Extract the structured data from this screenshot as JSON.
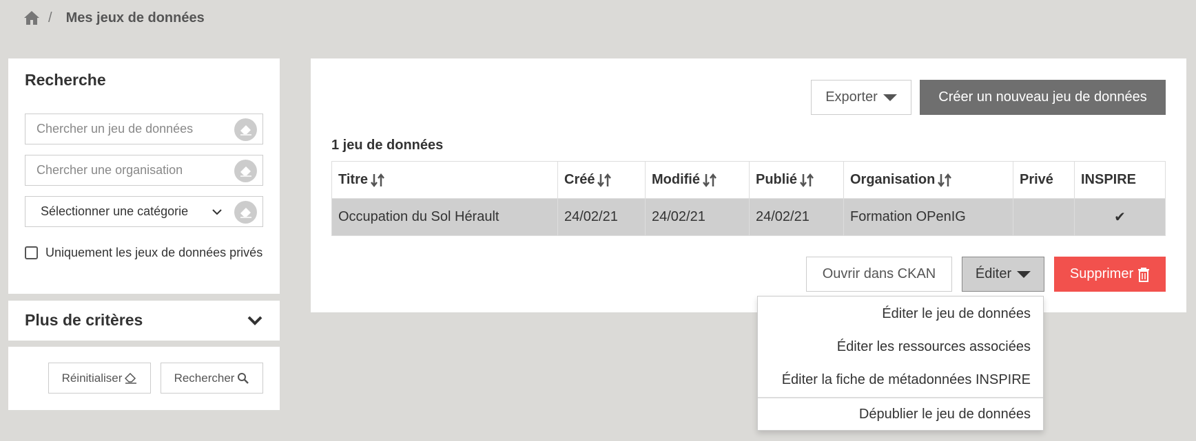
{
  "breadcrumb": {
    "separator": "/",
    "current": "Mes jeux de données"
  },
  "sidebar": {
    "search_title": "Recherche",
    "dataset_placeholder": "Chercher un jeu de données",
    "organisation_placeholder": "Chercher une organisation",
    "category_selected": "Sélectionner une catégorie",
    "private_only_label": "Uniquement les jeux de données privés",
    "more_criteria_title": "Plus de critères",
    "reset_label": "Réinitialiser",
    "search_label": "Rechercher"
  },
  "main": {
    "export_label": "Exporter",
    "create_label": "Créer un nouveau jeu de données",
    "count_label": "1 jeu de données",
    "columns": [
      "Titre",
      "Créé",
      "Modifié",
      "Publié",
      "Organisation",
      "Privé",
      "INSPIRE"
    ],
    "rows": [
      {
        "titre": "Occupation du Sol Hérault",
        "cree": "24/02/21",
        "modifie": "24/02/21",
        "publie": "24/02/21",
        "organisation": "Formation OPenIG",
        "prive": "",
        "inspire": "✔"
      }
    ],
    "open_ckan_label": "Ouvrir dans CKAN",
    "edit_label": "Éditer",
    "delete_label": "Supprimer"
  },
  "edit_menu": {
    "items": [
      "Éditer le jeu de données",
      "Éditer les ressources associées",
      "Éditer la fiche de métadonnées INSPIRE",
      "Dépublier le jeu de données"
    ]
  },
  "colors": {
    "background": "#dbdad7",
    "create_button": "#6f6f6f",
    "delete_button": "#f2514d",
    "selected_row": "#cfcfcf"
  }
}
